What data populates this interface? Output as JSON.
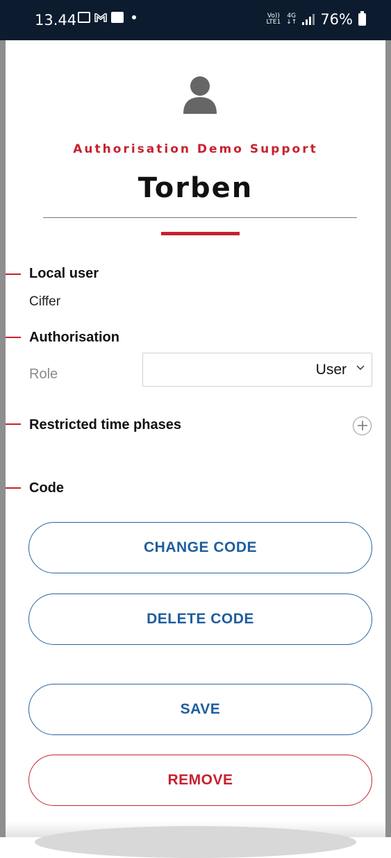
{
  "status_bar": {
    "time": "13.44",
    "network_top": "Vo))",
    "network_bottom": "LTE1",
    "net_type": "4G",
    "battery": "76%"
  },
  "profile": {
    "icon": "user-avatar-icon",
    "organization": "Authorisation Demo Support",
    "name": "Torben"
  },
  "sections": {
    "local_user": {
      "title": "Local user",
      "value": "Ciffer"
    },
    "authorisation": {
      "title": "Authorisation",
      "role_label": "Role",
      "role_value": "User"
    },
    "restricted": {
      "title": "Restricted time phases",
      "add_icon": "plus-circle-icon"
    },
    "code": {
      "title": "Code"
    }
  },
  "buttons": {
    "change_code": "CHANGE CODE",
    "delete_code": "DELETE CODE",
    "save": "SAVE",
    "remove": "REMOVE"
  },
  "colors": {
    "accent_red": "#c8202f",
    "button_blue": "#1e5da0",
    "status_bar": "#0d1b2e"
  }
}
